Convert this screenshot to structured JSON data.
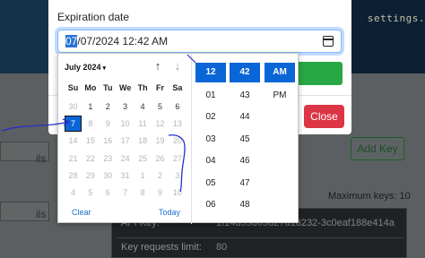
{
  "background": {
    "top_text": "settings."
  },
  "modal": {
    "field_label": "Expiration date",
    "date_value_selected": "07",
    "date_value_rest": "/07/2024  12:42  AM",
    "close_label": "Close"
  },
  "picker": {
    "month_label": "July 2024",
    "caret": "▾",
    "nav_up": "↑",
    "nav_down": "↓",
    "weekdays": [
      "Su",
      "Mo",
      "Tu",
      "We",
      "Th",
      "Fr",
      "Sa"
    ],
    "weeks": [
      [
        "30",
        "1",
        "2",
        "3",
        "4",
        "5",
        "6"
      ],
      [
        "7",
        "8",
        "9",
        "10",
        "11",
        "12",
        "13"
      ],
      [
        "14",
        "15",
        "16",
        "17",
        "18",
        "19",
        "20"
      ],
      [
        "21",
        "22",
        "23",
        "24",
        "25",
        "26",
        "27"
      ],
      [
        "28",
        "29",
        "30",
        "31",
        "1",
        "2",
        "3"
      ],
      [
        "4",
        "5",
        "6",
        "7",
        "8",
        "9",
        "10"
      ]
    ],
    "clear_label": "Clear",
    "today_label": "Today",
    "hours": [
      "12",
      "01",
      "02",
      "03",
      "04",
      "05",
      "06"
    ],
    "minutes": [
      "42",
      "43",
      "44",
      "45",
      "46",
      "47",
      "48"
    ],
    "periods": [
      "AM",
      "PM"
    ],
    "selected_hour": "12",
    "selected_minute": "42",
    "selected_period": "AM",
    "selected_day": "7"
  },
  "page": {
    "add_key_label": "Add Key",
    "max_keys_text": "Maximum keys: 10",
    "api_key_label": "API Key:",
    "api_key_value": "1f14d55d05d27d18232-3c0eaf188e414a",
    "requests_label": "Key requests limit:",
    "requests_value": "80"
  },
  "colors": {
    "accent": "#0a66d6",
    "save": "#28a745",
    "close": "#dc3545",
    "annotation": "#2430c8"
  }
}
